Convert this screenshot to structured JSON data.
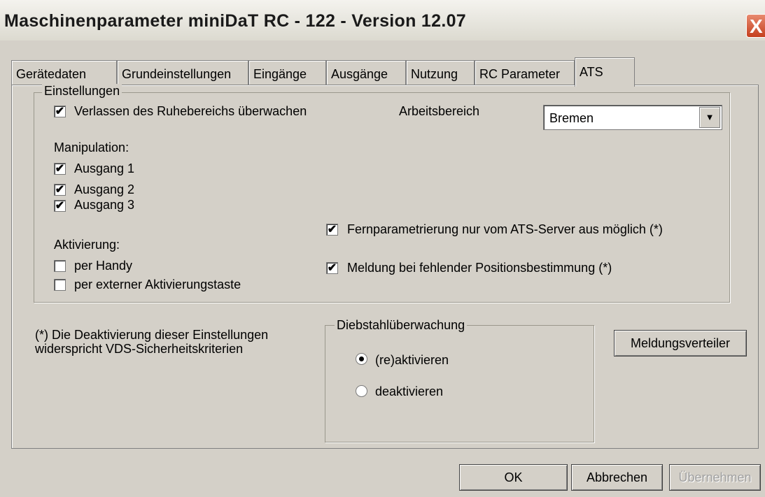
{
  "window": {
    "title": "Maschinenparameter miniDaT RC - 122 - Version 12.07",
    "close_glyph": "X"
  },
  "tabs": [
    "Gerätedaten",
    "Grundeinstellungen",
    "Eingänge",
    "Ausgänge",
    "Nutzung",
    "RC Parameter",
    "ATS"
  ],
  "active_tab": "ATS",
  "settings": {
    "group_label": "Einstellungen",
    "monitor_rest_area": {
      "label": "Verlassen des Ruhebereichs überwachen",
      "checked": true
    },
    "work_area_label": "Arbeitsbereich",
    "work_area_value": "Bremen",
    "manipulation_label": "Manipulation:",
    "outputs": [
      {
        "label": "Ausgang 1",
        "checked": true
      },
      {
        "label": "Ausgang 2",
        "checked": true
      },
      {
        "label": "Ausgang 3",
        "checked": true
      }
    ],
    "activation_label": "Aktivierung:",
    "activation_options": [
      {
        "label": "per Handy",
        "checked": false
      },
      {
        "label": "per externer Aktivierungstaste",
        "checked": false
      }
    ],
    "remote_param": {
      "label": "Fernparametrierung nur vom ATS-Server aus möglich (*)",
      "checked": true
    },
    "missing_position": {
      "label": "Meldung bei fehlender Positionsbestimmung (*)",
      "checked": true
    }
  },
  "note": {
    "line1": "(*) Die Deaktivierung dieser Einstellungen",
    "line2": "widerspricht VDS-Sicherheitskriterien"
  },
  "theft_monitoring": {
    "group_label": "Diebstahlüberwachung",
    "options": [
      {
        "label": "(re)aktivieren",
        "selected": true
      },
      {
        "label": "deaktivieren",
        "selected": false
      }
    ]
  },
  "buttons": {
    "distributor": "Meldungsverteiler",
    "ok": "OK",
    "cancel": "Abbrechen",
    "apply": "Übernehmen"
  },
  "check_glyph": "✔",
  "icons": {
    "dropdown": "chevron-down-icon",
    "close": "close-icon"
  }
}
